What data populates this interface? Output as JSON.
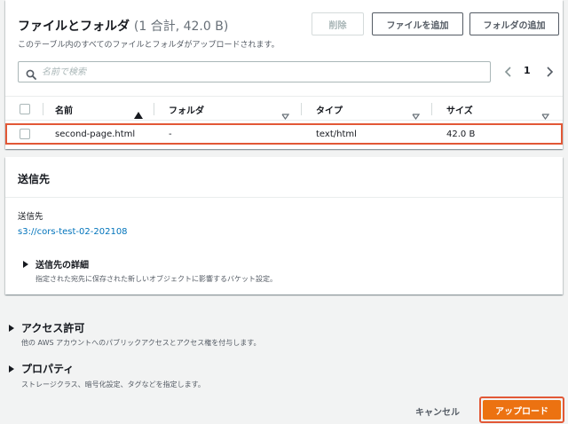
{
  "files": {
    "title": "ファイルとフォルダ",
    "count": "(1 合計, 42.0 B)",
    "description": "このテーブル内のすべてのファイルとフォルダがアップロードされます。",
    "buttons": {
      "delete": "削除",
      "add_files": "ファイルを追加",
      "add_folder": "フォルダの追加"
    },
    "search": {
      "placeholder": "名前で検索",
      "value": ""
    },
    "pagination": {
      "current_page": "1"
    },
    "columns": [
      {
        "label": "名前",
        "sort": "ascending"
      },
      {
        "label": "フォルダ"
      },
      {
        "label": "タイプ"
      },
      {
        "label": "サイズ"
      }
    ],
    "rows": [
      {
        "name": "second-page.html",
        "folder": "-",
        "type": "text/html",
        "size": "42.0 B"
      }
    ]
  },
  "destination": {
    "title": "送信先",
    "label": "送信先",
    "link": "s3://cors-test-02-202108",
    "details_title": "送信先の詳細",
    "details_desc": "指定された宛先に保存された新しいオブジェクトに影響するバケット設定。"
  },
  "permissions": {
    "title": "アクセス許可",
    "desc": "他の AWS アカウントへのパブリックアクセスとアクセス権を付与します。"
  },
  "properties": {
    "title": "プロパティ",
    "desc": "ストレージクラス、暗号化設定、タグなどを指定します。"
  },
  "footer": {
    "cancel": "キャンセル",
    "upload": "アップロード"
  },
  "colors": {
    "accent": "#ec7211",
    "highlight": "#e25836",
    "link": "#0073bb"
  },
  "icons": [
    "search-icon",
    "chevron-left-icon",
    "chevron-right-icon",
    "sort-ascending-icon",
    "sort-descending-icon",
    "caret-right-icon"
  ]
}
